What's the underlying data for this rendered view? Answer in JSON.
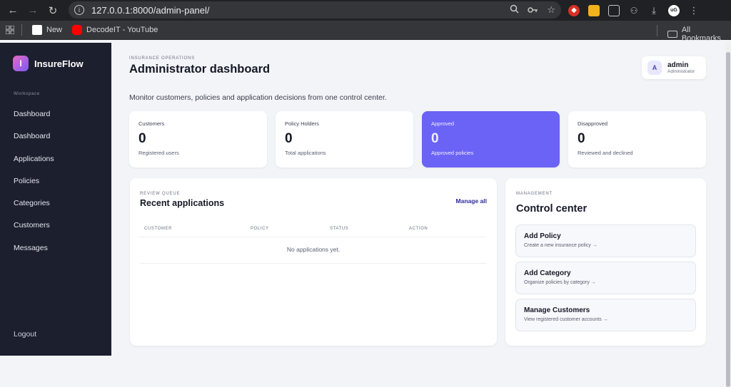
{
  "browser": {
    "url": "127.0.0.1:8000/admin-panel/",
    "bookmarks": [
      {
        "label": "New",
        "icon": "uxn-icon"
      },
      {
        "label": "DecodeIT - YouTube",
        "icon": "youtube-icon"
      }
    ],
    "all_bookmarks": "All Bookmarks",
    "profile_initials": "uG"
  },
  "brand": {
    "logo_letter": "I",
    "name": "InsureFlow"
  },
  "sidebar": {
    "section_label": "Workspace",
    "items": [
      {
        "label": "Dashboard"
      },
      {
        "label": "Dashboard"
      },
      {
        "label": "Applications"
      },
      {
        "label": "Policies"
      },
      {
        "label": "Categories"
      },
      {
        "label": "Customers"
      },
      {
        "label": "Messages"
      }
    ],
    "logout": "Logout"
  },
  "header": {
    "eyebrow": "INSURANCE OPERATIONS",
    "title": "Administrator dashboard",
    "description": "Monitor customers, policies and application decisions from one control center."
  },
  "user": {
    "avatar": "A",
    "name": "admin",
    "role": "Administrator"
  },
  "stats": [
    {
      "label": "Customers",
      "value": "0",
      "sub": "Registered users"
    },
    {
      "label": "Policy Holders",
      "value": "0",
      "sub": "Total applications"
    },
    {
      "label": "Approved",
      "value": "0",
      "sub": "Approved policies"
    },
    {
      "label": "Disapproved",
      "value": "0",
      "sub": "Reviewed and declined"
    }
  ],
  "recent": {
    "eyebrow": "REVIEW QUEUE",
    "title": "Recent applications",
    "manage_all": "Manage all",
    "columns": [
      "CUSTOMER",
      "POLICY",
      "STATUS",
      "ACTION"
    ],
    "empty": "No applications yet."
  },
  "control": {
    "eyebrow": "MANAGEMENT",
    "title": "Control center",
    "actions": [
      {
        "title": "Add Policy",
        "desc": "Create a new insurance policy →"
      },
      {
        "title": "Add Category",
        "desc": "Organize policies by category →"
      },
      {
        "title": "Manage Customers",
        "desc": "View registered customer accounts →"
      }
    ]
  },
  "colors": {
    "accent": "#6b63f5",
    "sidebar": "#1b1f2e",
    "link": "#2e2a9c"
  }
}
